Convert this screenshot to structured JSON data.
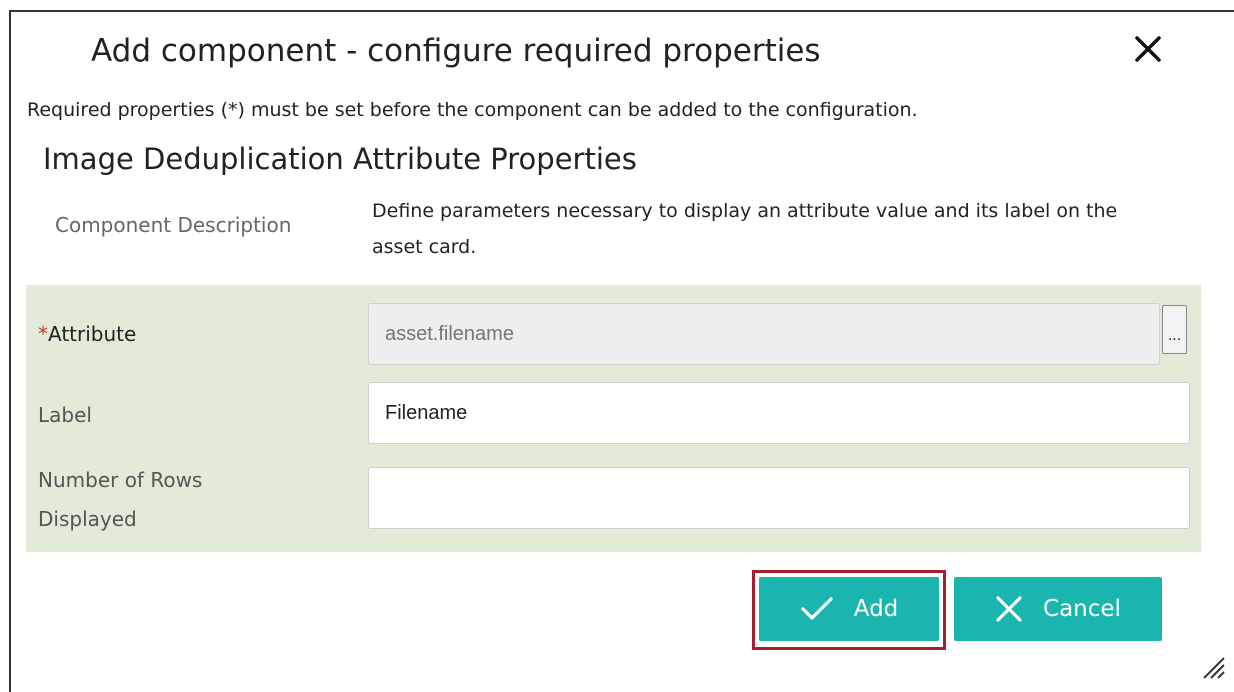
{
  "dialog": {
    "title": "Add component - configure required properties",
    "intro": "Required properties (*) must be set before the component can be added to the configuration.",
    "close_icon": "close-icon"
  },
  "section": {
    "title": "Image Deduplication Attribute Properties",
    "description_label": "Component Description",
    "description_text": "Define parameters necessary to display an attribute value and its label on the asset card."
  },
  "form": {
    "panel_color": "#e1ebd8",
    "attribute": {
      "required_marker": "*",
      "label": "Attribute",
      "placeholder": "asset.filename",
      "value": "",
      "browse_label": "..."
    },
    "label_field": {
      "label": "Label",
      "value": "Filename"
    },
    "rows_field": {
      "label_line1": "Number of Rows",
      "label_line2": "Displayed",
      "value": ""
    }
  },
  "buttons": {
    "add": {
      "label": "Add",
      "icon": "check-icon"
    },
    "cancel": {
      "label": "Cancel",
      "icon": "x-icon"
    },
    "accent_color": "#1bb5b0",
    "highlight_color": "#a5202e"
  }
}
